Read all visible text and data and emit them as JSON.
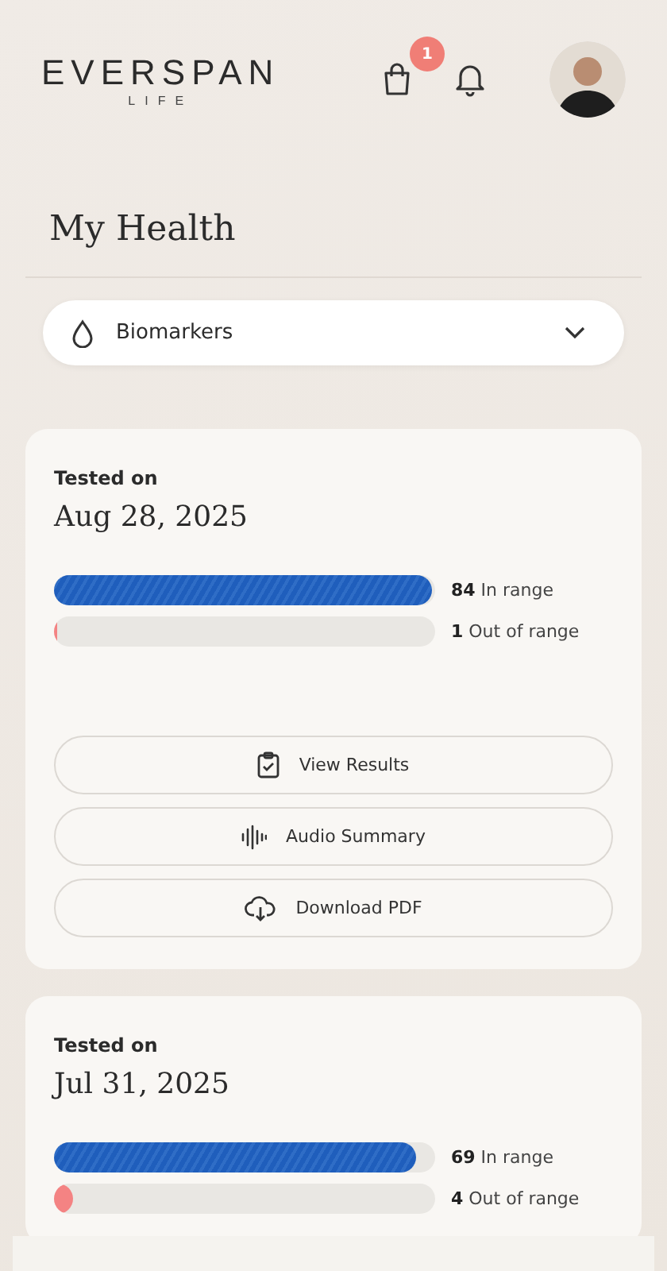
{
  "header": {
    "logo": "EVERSPAN",
    "logo_sub": "LIFE",
    "cart_badge": "1"
  },
  "page_title": "My Health",
  "dropdown": {
    "label": "Biomarkers"
  },
  "tests": [
    {
      "caption": "Tested on",
      "date": "Aug 28, 2025",
      "in_range": {
        "count": "84",
        "label": "In range",
        "level": 0.99
      },
      "out_of_range": {
        "count": "1",
        "label": "Out of range",
        "level": 0.01
      },
      "actions": [
        {
          "kind": "results",
          "label": "View Results"
        },
        {
          "kind": "audio",
          "label": "Audio Summary"
        },
        {
          "kind": "pdf",
          "label": "Download PDF"
        }
      ]
    },
    {
      "caption": "Tested on",
      "date": "Jul 31, 2025",
      "in_range": {
        "count": "69",
        "label": "In range",
        "level": 0.95
      },
      "out_of_range": {
        "count": "4",
        "label": "Out of range",
        "level": 0.05
      }
    }
  ]
}
